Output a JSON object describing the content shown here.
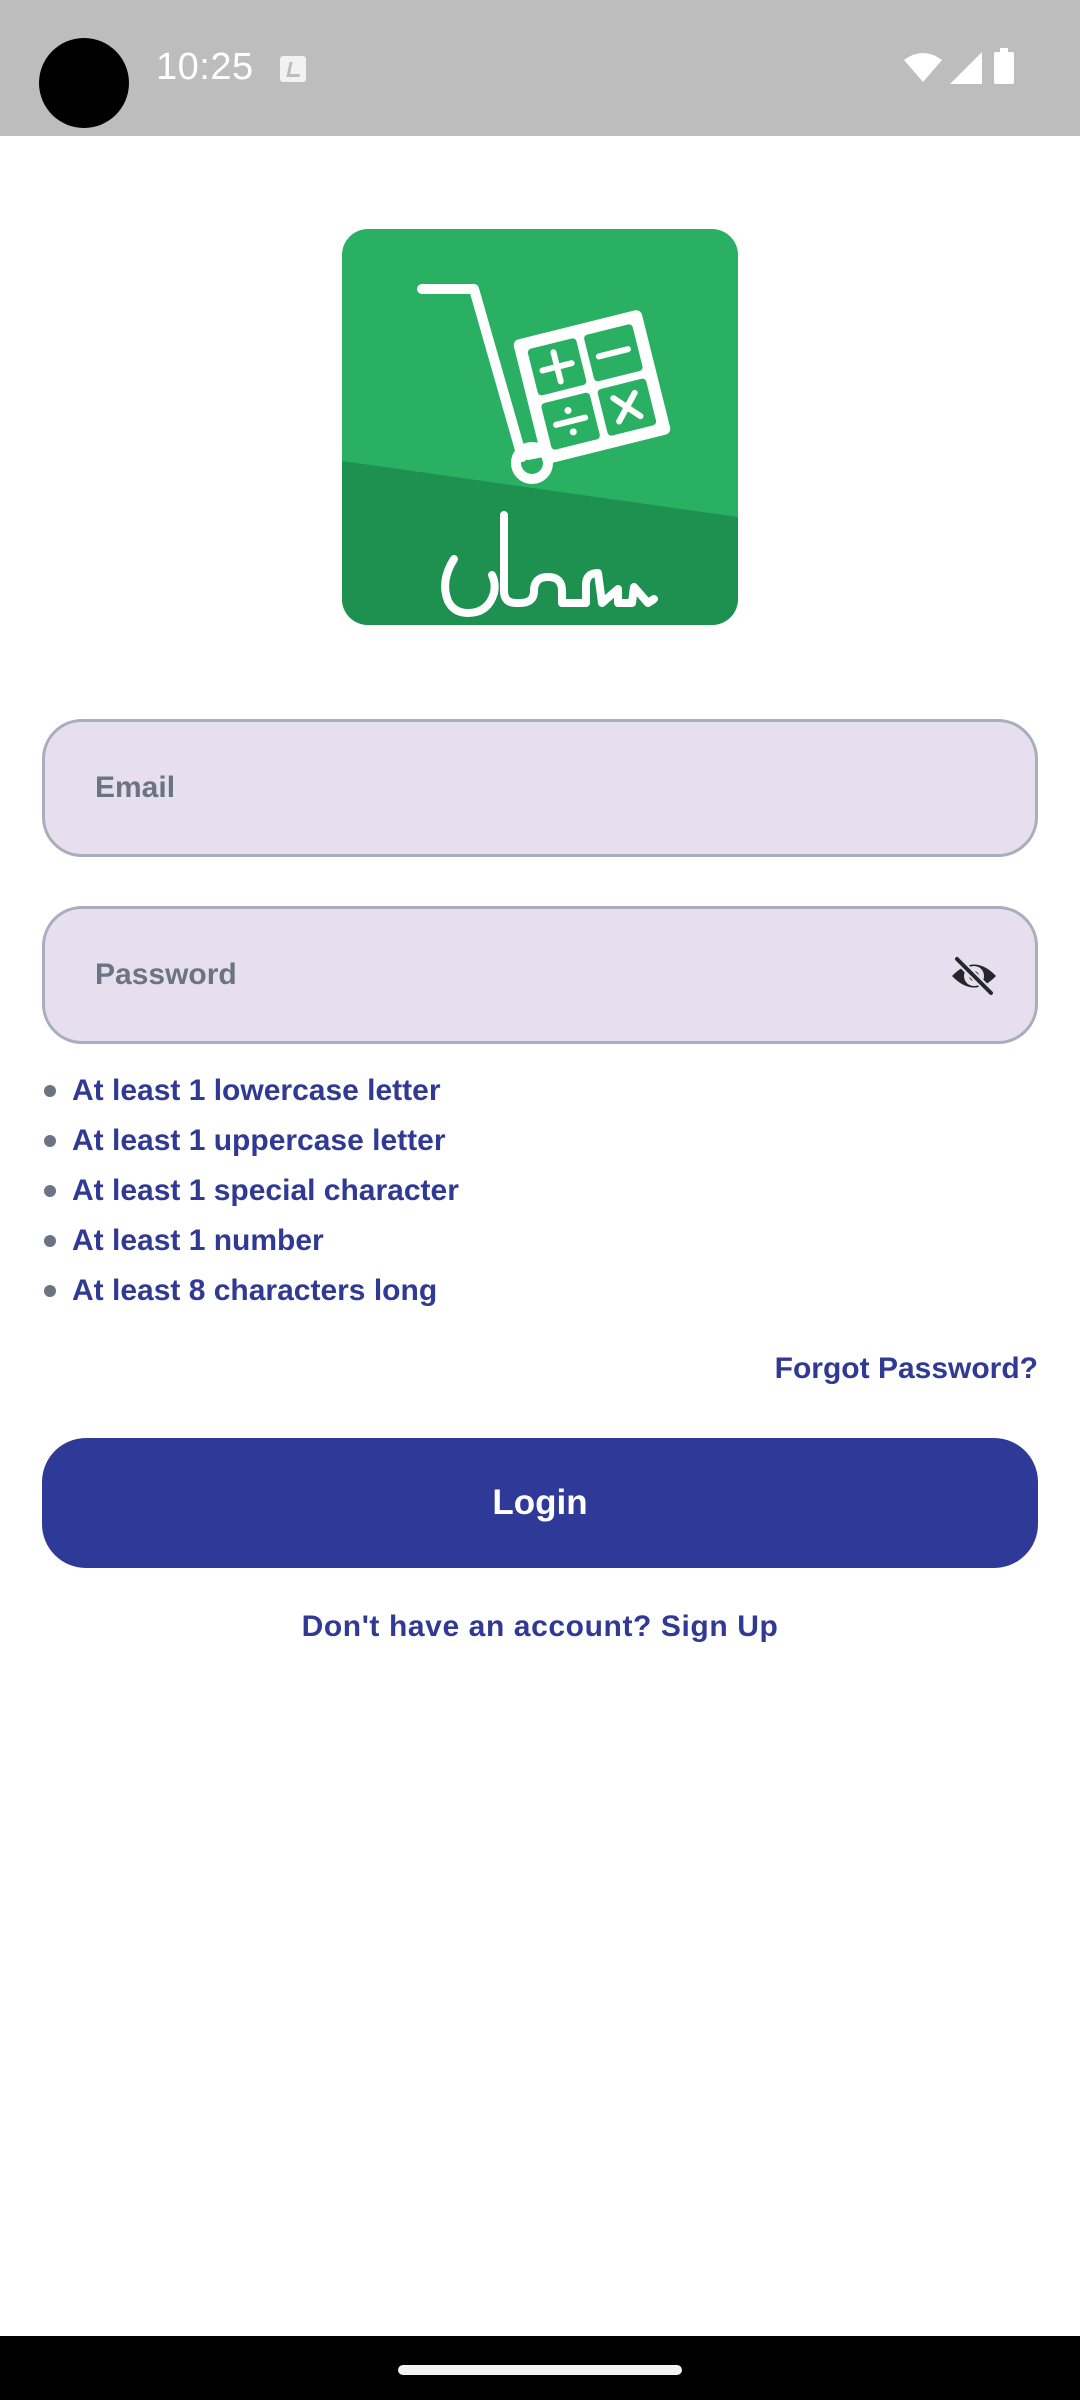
{
  "status_bar": {
    "time": "10:25"
  },
  "icons": {
    "camera": "camera-cutout",
    "notification": "app-notification-icon",
    "wifi": "wifi-icon",
    "signal": "cell-signal-icon",
    "battery": "battery-icon",
    "logo": "sahl-cart-calculator-logo",
    "visibility": "eye-off-icon"
  },
  "logo": {
    "text": "سهل"
  },
  "form": {
    "email_placeholder": "Email",
    "password_placeholder": "Password"
  },
  "password_rules": [
    "At least 1 lowercase letter",
    "At least 1 uppercase letter",
    "At least 1 special character",
    "At least 1 number",
    "At least 8 characters long"
  ],
  "actions": {
    "forgot_password": "Forgot Password?",
    "login": "Login",
    "signup": "Don't have an account? Sign Up"
  },
  "colors": {
    "primary": "#2f3997",
    "field_bg": "#e7dfee",
    "logo_green": "#29b062",
    "logo_green_dark": "#1e9150"
  }
}
